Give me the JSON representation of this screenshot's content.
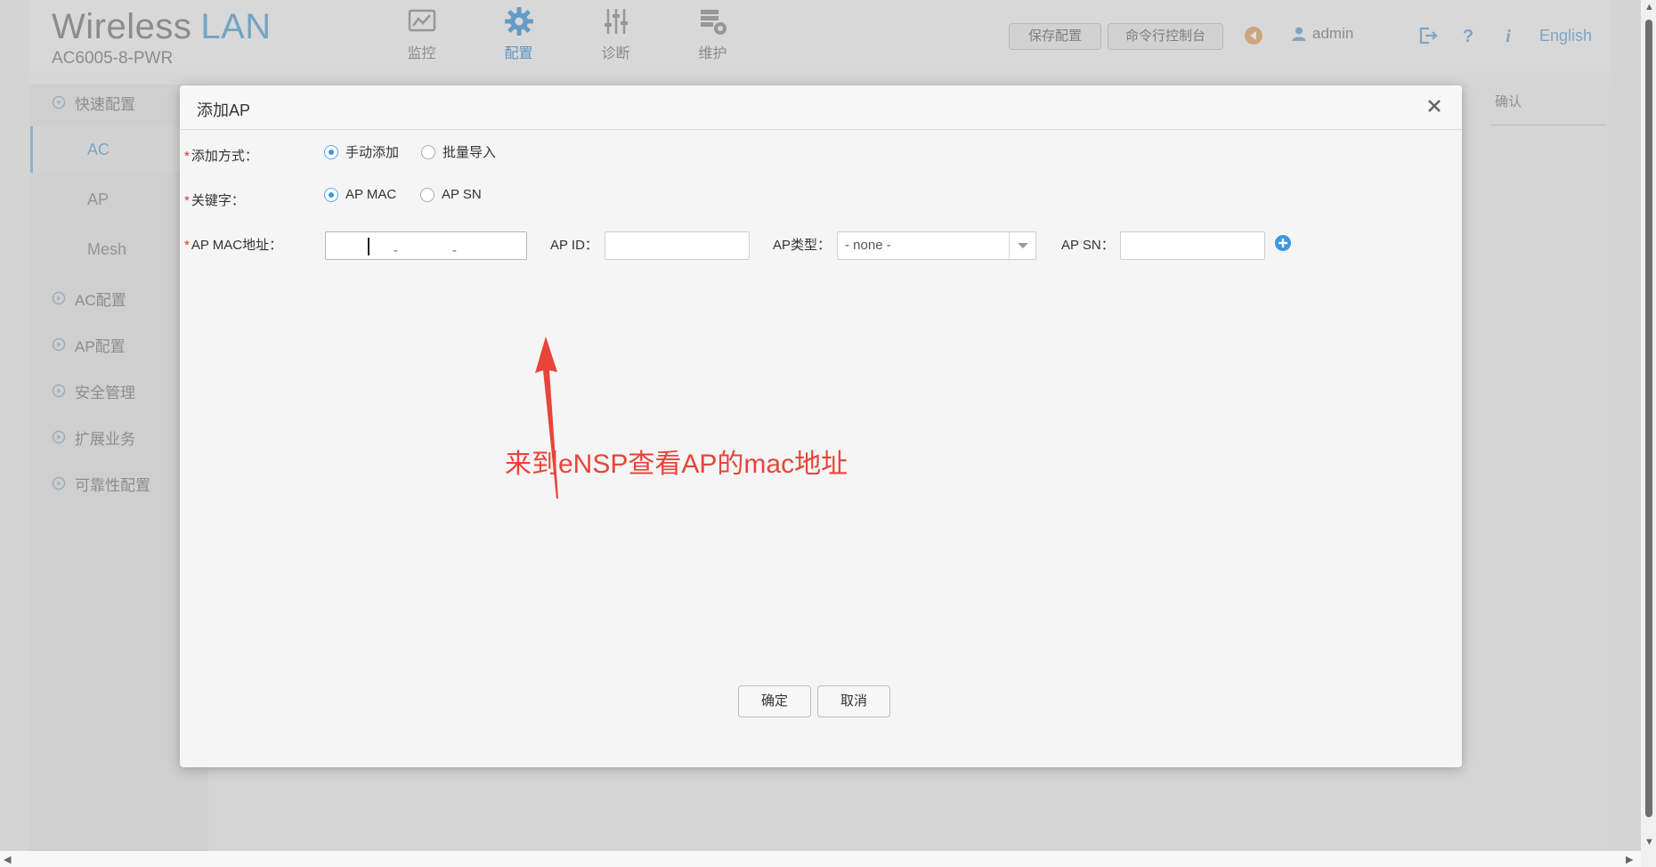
{
  "header": {
    "brand_title": "Wireless",
    "brand_lan": "LAN",
    "model": "AC6005-8-PWR",
    "nav": [
      {
        "label": "监控",
        "icon": "monitor-icon"
      },
      {
        "label": "配置",
        "icon": "gear-icon"
      },
      {
        "label": "诊断",
        "icon": "sliders-icon"
      },
      {
        "label": "维护",
        "icon": "maintenance-icon"
      }
    ],
    "save_config": "保存配置",
    "cli_console": "命令行控制台",
    "user": "admin",
    "language": "English"
  },
  "sidebar": {
    "quick_config": "快速配置",
    "sub_items": [
      "AC",
      "AP",
      "Mesh"
    ],
    "groups": [
      "AC配置",
      "AP配置",
      "安全管理",
      "扩展业务",
      "可靠性配置"
    ]
  },
  "content": {
    "hint": "确认"
  },
  "modal": {
    "title": "添加AP",
    "add_mode_label": "添加方式：",
    "add_mode_options": [
      "手动添加",
      "批量导入"
    ],
    "add_mode_selected": "手动添加",
    "keyword_label": "关键字：",
    "keyword_options": [
      "AP MAC",
      "AP SN"
    ],
    "keyword_selected": "AP MAC",
    "mac_label": "AP MAC地址：",
    "mac_sep": "-",
    "ap_id_label": "AP ID：",
    "ap_type_label": "AP类型：",
    "ap_type_value": "- none -",
    "ap_sn_label": "AP SN：",
    "confirm": "确定",
    "cancel": "取消"
  },
  "annotation": {
    "text": "来到eNSP查看AP的mac地址",
    "color": "#e8443a"
  },
  "colors": {
    "accent": "#3c97e0",
    "required": "#e03131"
  }
}
